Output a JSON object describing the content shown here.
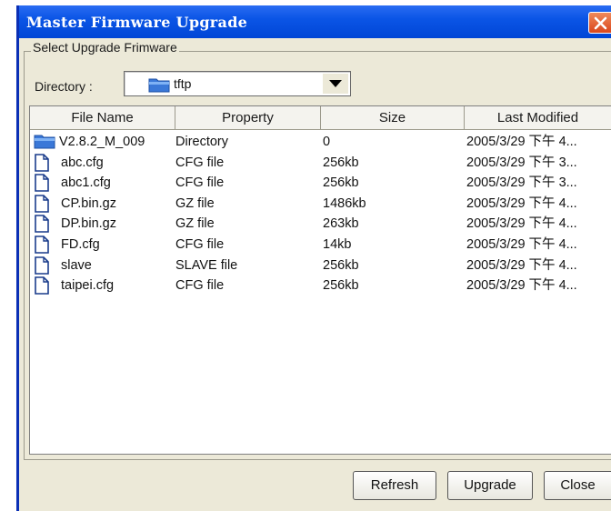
{
  "window": {
    "title": "Master Firmware Upgrade"
  },
  "group": {
    "legend": "Select Upgrade Frimware"
  },
  "directory": {
    "label": "Directory :",
    "value": "tftp"
  },
  "table": {
    "columns": [
      "File Name",
      "Property",
      "Size",
      "Last Modified"
    ],
    "rows": [
      {
        "name": "V2.8.2_M_009",
        "property": "Directory",
        "size": "0",
        "modified": "2005/3/29 下午 4...",
        "icon": "folder-icon"
      },
      {
        "name": "abc.cfg",
        "property": "CFG file",
        "size": "256kb",
        "modified": "2005/3/29 下午 3...",
        "icon": "file-icon"
      },
      {
        "name": "abc1.cfg",
        "property": "CFG file",
        "size": "256kb",
        "modified": "2005/3/29 下午 3...",
        "icon": "file-icon"
      },
      {
        "name": "CP.bin.gz",
        "property": "GZ file",
        "size": "1486kb",
        "modified": "2005/3/29 下午 4...",
        "icon": "file-icon"
      },
      {
        "name": "DP.bin.gz",
        "property": "GZ file",
        "size": "263kb",
        "modified": "2005/3/29 下午 4...",
        "icon": "file-icon"
      },
      {
        "name": "FD.cfg",
        "property": "CFG file",
        "size": "14kb",
        "modified": "2005/3/29 下午 4...",
        "icon": "file-icon"
      },
      {
        "name": "slave",
        "property": "SLAVE file",
        "size": "256kb",
        "modified": "2005/3/29 下午 4...",
        "icon": "file-icon"
      },
      {
        "name": "taipei.cfg",
        "property": "CFG file",
        "size": "256kb",
        "modified": "2005/3/29 下午 4...",
        "icon": "file-icon"
      }
    ]
  },
  "buttons": {
    "refresh": "Refresh",
    "upgrade": "Upgrade",
    "close": "Close"
  },
  "colors": {
    "titlebar": "#0b55e6",
    "dialog": "#ece9d8",
    "folder": "#3a78d8"
  }
}
